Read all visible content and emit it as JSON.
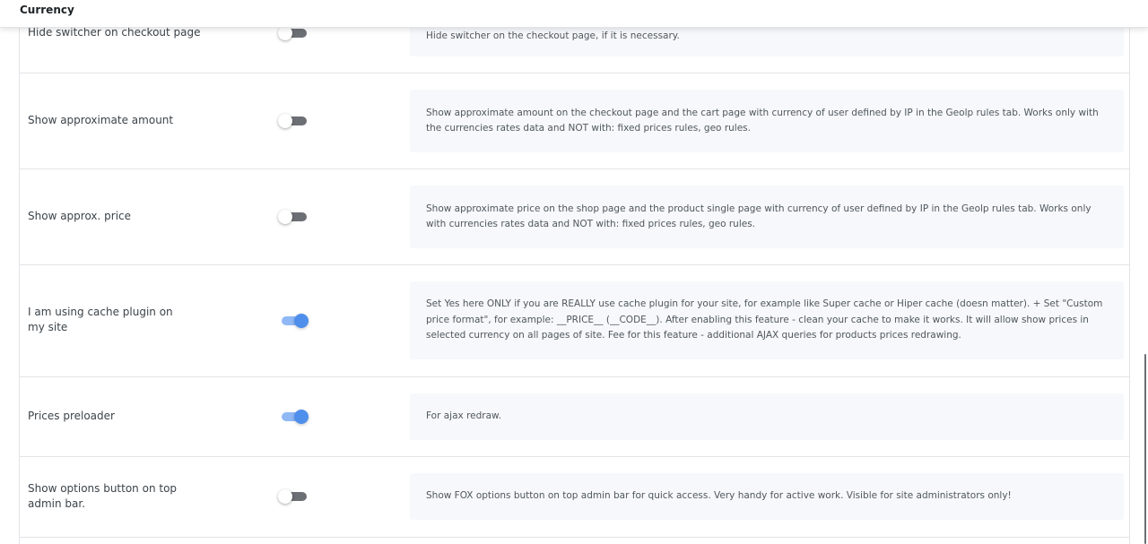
{
  "header": {
    "title": "Currency"
  },
  "settings": [
    {
      "label": "Hide switcher on checkout page",
      "enabled": false,
      "description": "Hide switcher on the checkout page, if it is necessary."
    },
    {
      "label": "Show approximate amount",
      "enabled": false,
      "description": "Show approximate amount on the checkout page and the cart page with currency of user defined by IP in the Geolp rules tab. Works only with the currencies rates data and NOT with: fixed prices rules, geo rules."
    },
    {
      "label": "Show approx. price",
      "enabled": false,
      "description": "Show approximate price on the shop page and the product single page with currency of user defined by IP in the Geolp rules tab. Works only with currencies rates data and NOT with: fixed prices rules, geo rules."
    },
    {
      "label": "I am using cache plugin on my site",
      "enabled": true,
      "description": "Set Yes here ONLY if you are REALLY use cache plugin for your site, for example like Super cache or Hiper cache (doesn matter). + Set \"Custom price format\", for example: __PRICE__ (__CODE__). After enabling this feature - clean your cache to make it works. It will allow show prices in selected currency on all pages of site. Fee for this feature - additional AJAX queries for products prices redrawing."
    },
    {
      "label": "Prices preloader",
      "enabled": true,
      "description": "For ajax redraw."
    },
    {
      "label": "Show options button on top admin bar.",
      "enabled": false,
      "description": "Show FOX options button on top admin bar for quick access. Very handy for active work. Visible for site administrators only!"
    }
  ]
}
